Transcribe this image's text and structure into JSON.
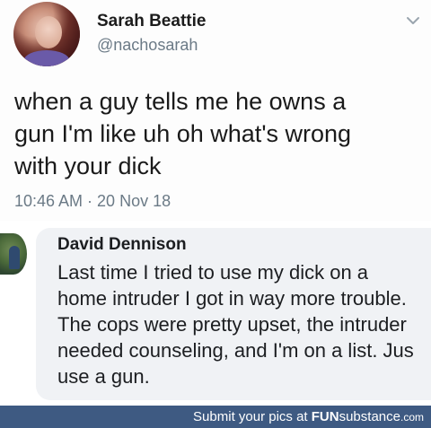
{
  "tweet": {
    "author_name": "Sarah Beattie",
    "author_handle": "@nachosarah",
    "text_lines": [
      "when a guy tells me he owns a",
      "gun I'm like uh oh what's wrong",
      "with your dick"
    ],
    "timestamp": "10:46 AM · 20 Nov 18",
    "menu_icon": "chevron-down-icon"
  },
  "reply": {
    "author_name": "David Dennison",
    "text_lines": [
      "Last time I tried to use my dick on a",
      "home intruder I got in way more trouble.",
      "The cops were pretty upset, the intruder",
      "needed counseling, and I'm on a list. Jus",
      "use a gun."
    ]
  },
  "footer": {
    "prefix": "Submit your pics at ",
    "brand_bold": "FUN",
    "brand_rest": "substance",
    "brand_tld": ".com"
  },
  "colors": {
    "footer_bg": "#3e5a82",
    "bubble_bg": "#f0f2f5",
    "muted_text": "#6b7a86"
  }
}
